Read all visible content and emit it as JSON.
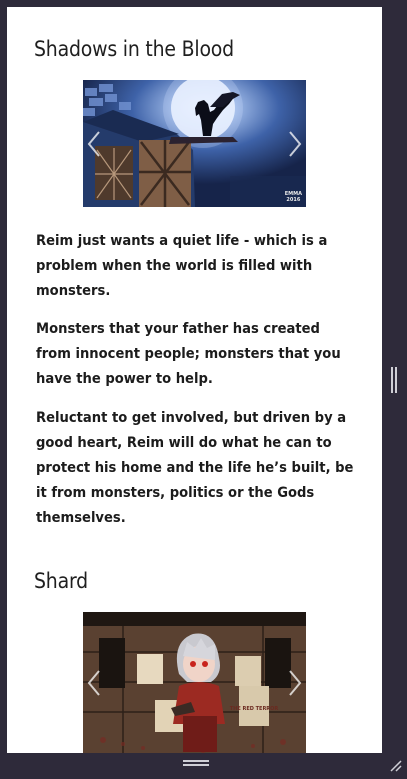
{
  "book1": {
    "title": "Shadows in the Blood",
    "paragraphs": [
      "Reim just wants a quiet life - which is a problem when the world is filled with monsters.",
      "Monsters that your father has created from innocent people; monsters that you have the power to help.",
      "Reluctant to get involved, but driven by a good heart, Reim will do what he can to protect his home and the life he’s built, be it from monsters, politics or the Gods themselves."
    ],
    "watermark": [
      "EMMA",
      "2016"
    ]
  },
  "book2": {
    "title": "Shard",
    "poster_text": "THE RED TERROR"
  },
  "colors": {
    "frame": "#2e2a3a",
    "page": "#ffffff",
    "text": "#1c1c1c"
  },
  "icons": [
    "chevron-left-icon",
    "chevron-right-icon",
    "resize-grip-icon",
    "drag-handle-icon"
  ]
}
